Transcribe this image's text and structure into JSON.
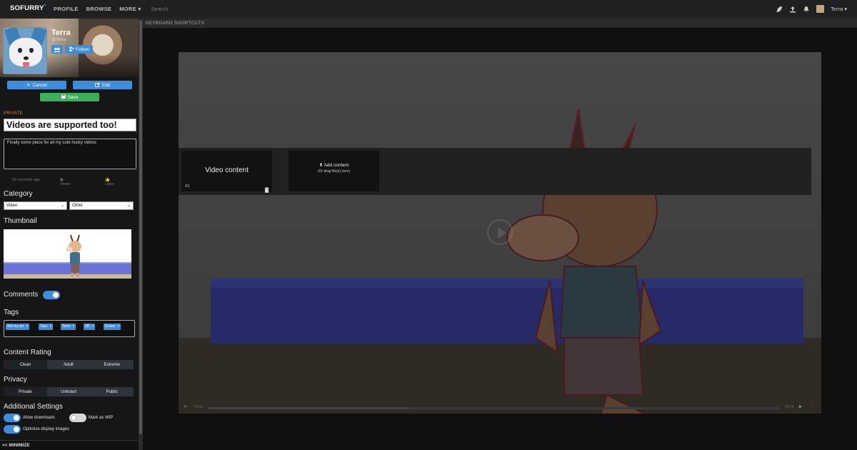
{
  "nav": {
    "logo": "SOFURRY",
    "logo_mark": "*",
    "links": [
      "PROFILE",
      "BROWSE",
      "MORE"
    ],
    "search_placeholder": "Search",
    "username": "Terra"
  },
  "profile": {
    "name": "Terra",
    "handle": "@Terra",
    "follow_label": "Follow"
  },
  "actions": {
    "cancel": "Cancel",
    "edit": "Edit",
    "save": "Save"
  },
  "submission": {
    "visibility_badge": "PRIVATE",
    "title": "Videos are supported too!",
    "description": "Finally some place for all my cute husky videos",
    "posted": "59 seconds ago",
    "views": "1 Views",
    "likes": "0 Likes"
  },
  "category": {
    "label": "Category",
    "primary": "Video",
    "secondary": "Other"
  },
  "thumbnail": {
    "label": "Thumbnail"
  },
  "comments": {
    "label": "Comments",
    "enabled": true
  },
  "tags": {
    "label": "Tags",
    "items": [
      "Not my art",
      "Taxo",
      "Terra",
      "3D",
      "Drawn"
    ]
  },
  "content_rating": {
    "label": "Content Rating",
    "options": [
      "Clean",
      "Adult",
      "Extreme"
    ],
    "selected": "Adult"
  },
  "privacy": {
    "label": "Privacy",
    "options": [
      "Private",
      "Unlisted",
      "Public"
    ],
    "selected": "Unlisted"
  },
  "additional": {
    "label": "Additional Settings",
    "allow_downloads": "Allow downloads",
    "mark_wip": "Mark as WIP",
    "optimize_images": "Optimize display images"
  },
  "minimize_label": "<< MINIMIZE",
  "main": {
    "shortcuts_label": "KEYBOARD SHORTCUTS",
    "video_card_label": "Video content",
    "video_card_index": "#1",
    "add_content_label": "Add content",
    "add_content_hint": "(Or drag file(s) here)",
    "player_time_current": "00:00",
    "player_time_total": "00:05",
    "playback_progress": 0.35
  },
  "colors": {
    "accent": "#3d8ddc",
    "save": "#3fae5a",
    "private_badge": "#e8843a"
  }
}
